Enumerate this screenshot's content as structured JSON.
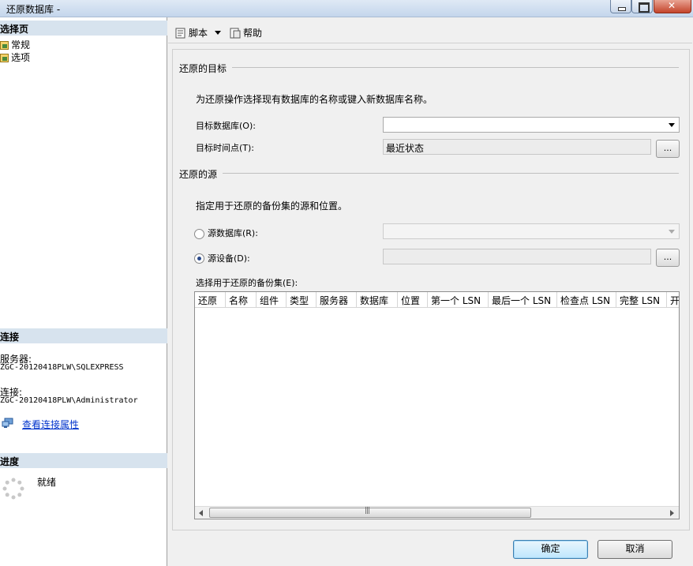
{
  "window": {
    "title": "还原数据库 -"
  },
  "left": {
    "select_page_header": "选择页",
    "pages": [
      {
        "label": "常规"
      },
      {
        "label": "选项"
      }
    ],
    "connection_header": "连接",
    "server_label": "服务器:",
    "server_value": "ZGC-20120418PLW\\SQLEXPRESS",
    "connection_label": "连接:",
    "connection_value": "ZGC-20120418PLW\\Administrator",
    "view_props_link": "查看连接属性",
    "progress_header": "进度",
    "progress_status": "就绪"
  },
  "toolbar": {
    "script_label": "脚本",
    "help_label": "帮助"
  },
  "destination": {
    "group_title": "还原的目标",
    "hint": "为还原操作选择现有数据库的名称或键入新数据库名称。",
    "target_db_label": "目标数据库(O):",
    "target_db_value": "",
    "target_time_label": "目标时间点(T):",
    "target_time_value": "最近状态",
    "ellipsis": "..."
  },
  "source": {
    "group_title": "还原的源",
    "hint": "指定用于还原的备份集的源和位置。",
    "from_database_label": "源数据库(R):",
    "from_device_label": "源设备(D):",
    "selected_option": "from_device",
    "ellipsis": "..."
  },
  "backup_sets": {
    "label": "选择用于还原的备份集(E):",
    "columns": [
      "还原",
      "名称",
      "组件",
      "类型",
      "服务器",
      "数据库",
      "位置",
      "第一个 LSN",
      "最后一个 LSN",
      "检查点 LSN",
      "完整 LSN",
      "开"
    ],
    "rows": []
  },
  "buttons": {
    "ok": "确定",
    "cancel": "取消"
  }
}
